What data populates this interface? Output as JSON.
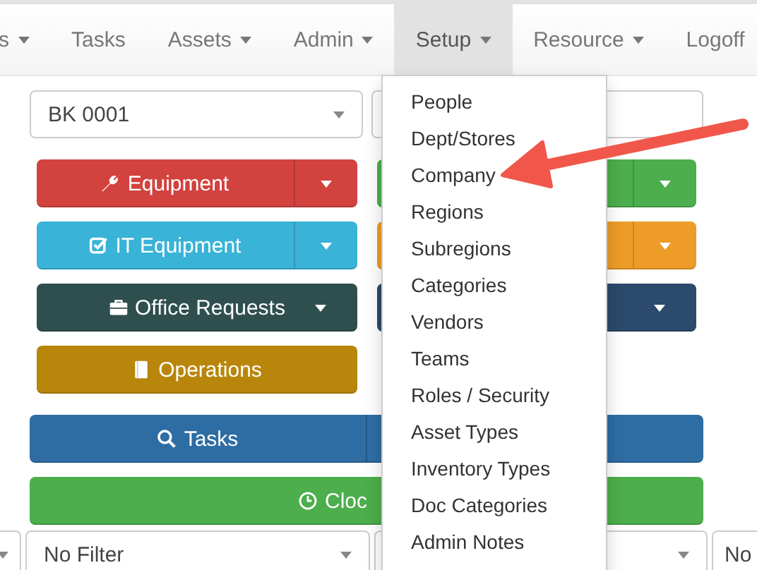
{
  "nav": {
    "items": [
      {
        "label": "s",
        "dropdown": true,
        "selected": false
      },
      {
        "label": "Tasks",
        "dropdown": false,
        "selected": false
      },
      {
        "label": "Assets",
        "dropdown": true,
        "selected": false
      },
      {
        "label": "Admin",
        "dropdown": true,
        "selected": false
      },
      {
        "label": "Setup",
        "dropdown": true,
        "selected": true
      },
      {
        "label": "Resource",
        "dropdown": true,
        "selected": false
      },
      {
        "label": "Logoff",
        "dropdown": false,
        "selected": false
      }
    ]
  },
  "location_select": {
    "value": "BK 0001"
  },
  "left_buttons": [
    {
      "label": "Equipment",
      "color": "#d2423e",
      "split": true
    },
    {
      "label": "IT Equipment",
      "color": "#39b3d7",
      "split": true
    },
    {
      "label": "Office Requests",
      "color": "#2f4f4f",
      "split": false,
      "caret": true
    },
    {
      "label": "Operations",
      "color": "#b8860b",
      "split": false,
      "caret": false
    }
  ],
  "right_buttons": [
    {
      "color": "#4cae4c",
      "split": true
    },
    {
      "color": "#ed9c28",
      "split": true
    },
    {
      "color": "#2c4a6b",
      "split": false,
      "caret": true
    }
  ],
  "wide_buttons": [
    {
      "label": "Tasks",
      "color": "#2e6da4",
      "split": true
    },
    {
      "label": "Cloc",
      "color": "#4cae4c",
      "split": false
    }
  ],
  "filters": [
    "No Filter",
    "No"
  ],
  "setup_menu": {
    "items": [
      "People",
      "Dept/Stores",
      "Company",
      "Regions",
      "Subregions",
      "Categories",
      "Vendors",
      "Teams",
      "Roles / Security",
      "Asset Types",
      "Inventory Types",
      "Doc Categories",
      "Admin Notes"
    ]
  }
}
